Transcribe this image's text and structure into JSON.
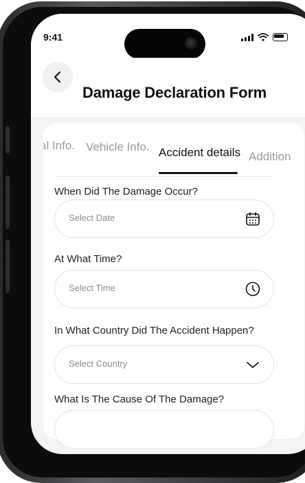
{
  "status_bar": {
    "time": "9:41",
    "icons": [
      "signal-icon",
      "wifi-icon",
      "battery-icon"
    ]
  },
  "header": {
    "back_icon": "chevron-left-icon",
    "title": "Damage Declaration Form"
  },
  "tabs": [
    {
      "label": "al Info.",
      "active": false
    },
    {
      "label": "Vehicle Info.",
      "active": false
    },
    {
      "label": "Accident details",
      "active": true
    },
    {
      "label": "Addition",
      "active": false
    }
  ],
  "form": {
    "damage_date": {
      "label": "When Did The Damage Occur?",
      "placeholder": "Select Date",
      "icon": "calendar-icon"
    },
    "damage_time": {
      "label": "At What Time?",
      "placeholder": "Select Time",
      "icon": "clock-icon"
    },
    "country": {
      "label": "In What Country Did The Accident Happen?",
      "placeholder": "Select Country",
      "icon": "chevron-down-icon"
    },
    "cause": {
      "label": "What Is The Cause Of The Damage?"
    }
  },
  "colors": {
    "background": "#f4f4f5",
    "card": "#ffffff",
    "text": "#111111",
    "muted": "#9a9aa0",
    "border": "#e2e2e5"
  }
}
